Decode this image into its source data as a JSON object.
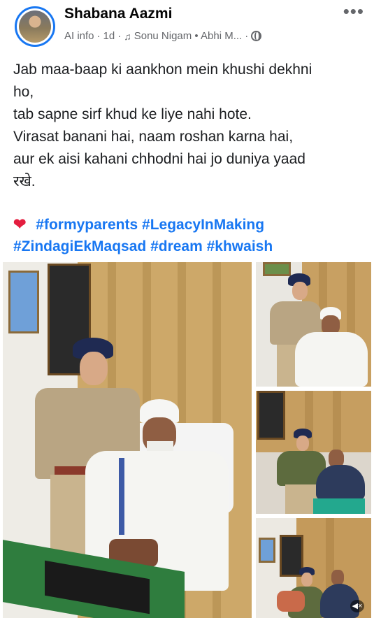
{
  "post": {
    "author": "Shabana Aazmi",
    "meta": {
      "ai_info": "AI info",
      "age": "1d",
      "music": "Sonu Nigam • Abhi M...",
      "separator": "·"
    },
    "caption_lines": [
      "Jab maa-baap ki aankhon mein khushi dekhni",
      "ho,",
      "tab sapne sirf khud ke liye nahi hote.",
      "Virasat banani hai, naam roshan karna hai,",
      "aur ek aisi kahani chhodni hai jo duniya yaad",
      "रखे."
    ],
    "hashtags": {
      "line1": [
        "#formyparents",
        "#LegacyInMaking"
      ],
      "line2": [
        "#ZindagiEkMaqsad",
        "#dream",
        "#khwaish"
      ]
    }
  },
  "icons": {
    "avatar": "profile-photo",
    "music": "music-note-icon",
    "audience": "globe-icon",
    "more": "more-dots-icon",
    "heart": "red-heart-icon",
    "sound": "speaker-muted-icon"
  },
  "colors": {
    "link": "#1877f2",
    "secondary_text": "#65676b",
    "heart": "#e41e3f"
  }
}
